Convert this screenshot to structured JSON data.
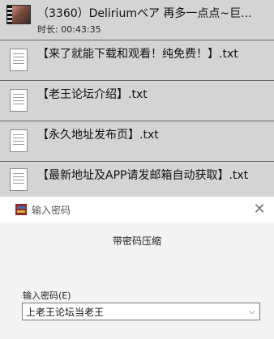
{
  "files": {
    "video": {
      "title": "（3360）Deliriumベア 再多一点点~巨...",
      "duration": "时长: 00:43:35",
      "thumbnail_icon": "video-thumbnail-icon"
    },
    "items": [
      {
        "name": "【来了就能下载和观看！纯免费！】.txt",
        "icon": "text-file-icon"
      },
      {
        "name": "【老王论坛介绍】.txt",
        "icon": "text-file-icon"
      },
      {
        "name": "【永久地址发布页】.txt",
        "icon": "text-file-icon"
      },
      {
        "name": "【最新地址及APP请发邮箱自动获取】.txt",
        "icon": "text-file-icon"
      }
    ]
  },
  "dialog": {
    "title": "输入密码",
    "heading": "带密码压缩",
    "password_label": "输入密码(E)",
    "password_value": "上老王论坛当老王",
    "close_icon": "close-icon",
    "app_icon": "winrar-icon"
  },
  "colors": {
    "list_background": "#d4d4d4",
    "dialog_background": "#f3f3f3"
  }
}
